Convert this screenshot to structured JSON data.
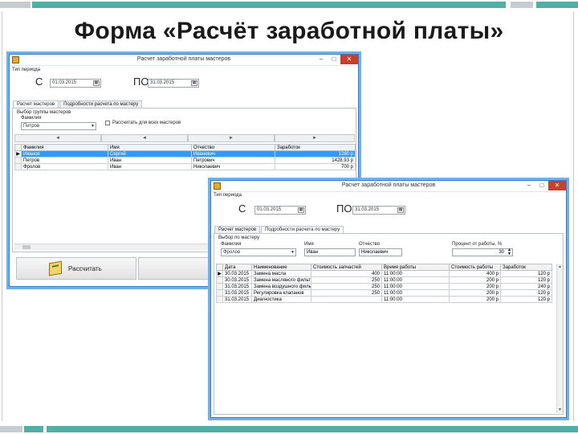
{
  "slide": {
    "title": "Форма «Расчёт заработной платы»",
    "colors": {
      "teal_bar": "#4fb0a7",
      "gray_bar": "#c7ccd0",
      "window_border": "#2a7fd4",
      "selection": "#3399ff"
    }
  },
  "window1": {
    "title": "Расчет заработной платы мастеров",
    "icon": "app-icon",
    "controls": {
      "minimize": "–",
      "maximize": "□",
      "close": "✕"
    },
    "period_group_label": "Тип периода",
    "from_label": "С",
    "from_date": "01.03.2015",
    "to_label": "ПО",
    "to_date": "31.03.2015",
    "tabs": [
      "Расчет мастеров",
      "Подробности расчета по мастеру"
    ],
    "filter_group_label": "Выбор группы мастеров",
    "surname_label": "Фамилия",
    "surname_value": "Петров",
    "checkbox_label": "Рассчитать для всех мастеров",
    "nav": [
      "◄",
      "◄",
      "►",
      "►"
    ],
    "grid": {
      "columns": [
        "Фамилия",
        "Имя",
        "Отчество",
        "Заработок"
      ],
      "rows": [
        [
          "Иванов",
          "Сергей",
          "Иванович",
          "1280 р"
        ],
        [
          "Петров",
          "Иван",
          "Петрович",
          "1428.93 р"
        ],
        [
          "Фролов",
          "Иван",
          "Николаевич",
          "700 р"
        ]
      ]
    },
    "calc_button": "Рассчитать"
  },
  "window2": {
    "title": "Расчет заработной платы мастеров",
    "icon": "app-icon",
    "controls": {
      "minimize": "–",
      "maximize": "□",
      "close": "✕"
    },
    "period_group_label": "Тип периода",
    "from_label": "С",
    "from_date": "01.03.2015",
    "to_label": "ПО",
    "to_date": "31.03.2015",
    "tabs": [
      "Расчет мастеров",
      "Подробности расчета по мастеру"
    ],
    "master_group_label": "Выбор по мастеру",
    "surname_label": "Фамилия",
    "surname_value": "Фролов",
    "name_label": "Имя",
    "name_value": "Иван",
    "patronymic_label": "Отчество",
    "patronymic_value": "Николаевич",
    "percent_label": "Процент от работы, %",
    "percent_value": "30",
    "grid": {
      "columns": [
        "Дата",
        "Наименование",
        "Стоимость запчастей",
        "Время работы",
        "Стоимость работы",
        "Заработок"
      ],
      "rows": [
        [
          "30.03.2015",
          "Замена масла",
          "400",
          "11:00:00",
          "400 р",
          "120 р"
        ],
        [
          "30.03.2015",
          "Замена масляного фильтра",
          "250",
          "11:00:00",
          "200 р",
          "120 р"
        ],
        [
          "31.03.2015",
          "Замена воздушного фильтра",
          "250",
          "11:00:00",
          "200 р",
          "240 р"
        ],
        [
          "31.03.2015",
          "Регулировка клапанов",
          "250",
          "11:00:00",
          "200 р",
          "120 р"
        ],
        [
          "31.03.2015",
          "Диагностика",
          "",
          "11:00:00",
          "200 р",
          "120 р"
        ]
      ]
    }
  }
}
